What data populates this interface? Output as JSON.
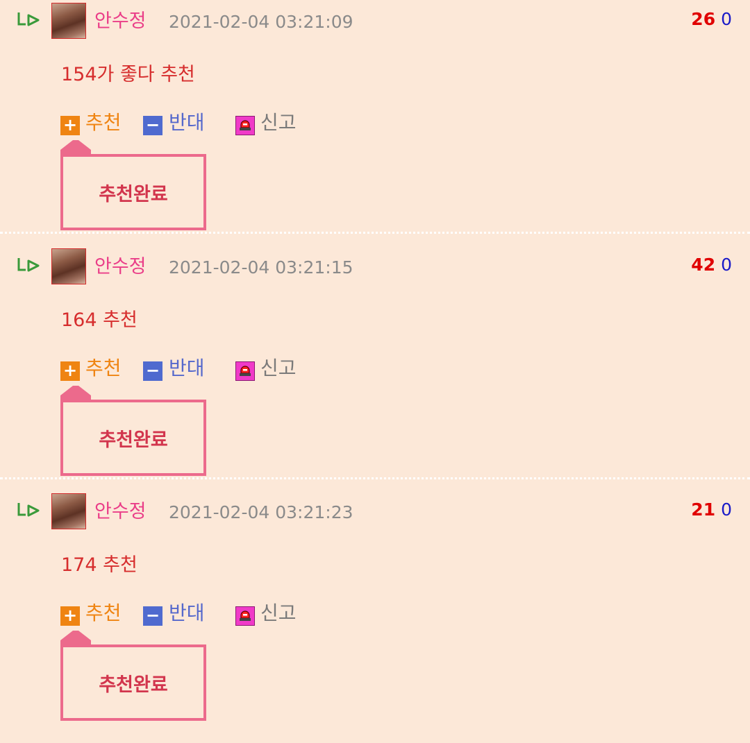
{
  "comments": [
    {
      "author": "안수정",
      "timestamp": "2021-02-04 03:21:09",
      "upvotes": "26",
      "downvotes": "0",
      "content": "154가 좋다 추천",
      "vote_up_label": "추천",
      "vote_down_label": "반대",
      "report_label": "신고",
      "notice": "추천완료"
    },
    {
      "author": "안수정",
      "timestamp": "2021-02-04 03:21:15",
      "upvotes": "42",
      "downvotes": "0",
      "content": "164 추천",
      "vote_up_label": "추천",
      "vote_down_label": "반대",
      "report_label": "신고",
      "notice": "추천완료"
    },
    {
      "author": "안수정",
      "timestamp": "2021-02-04 03:21:23",
      "upvotes": "21",
      "downvotes": "0",
      "content": "174 추천",
      "vote_up_label": "추천",
      "vote_down_label": "반대",
      "report_label": "신고",
      "notice": "추천완료"
    }
  ],
  "icons": {
    "reply": "reply-arrow-icon",
    "vote_up": "plus-icon",
    "vote_down": "minus-icon",
    "report": "siren-icon"
  },
  "colors": {
    "background": "#fce8d8",
    "author": "#ea3d88",
    "upvotes": "#e00000",
    "downvotes": "#1a1ac8",
    "content": "#d62d2d",
    "vote_up": "#ef8412",
    "vote_down": "#4f6acf",
    "report": "#f03ac8",
    "notice_border": "#ec6a8c",
    "notice_text": "#d2354d"
  }
}
